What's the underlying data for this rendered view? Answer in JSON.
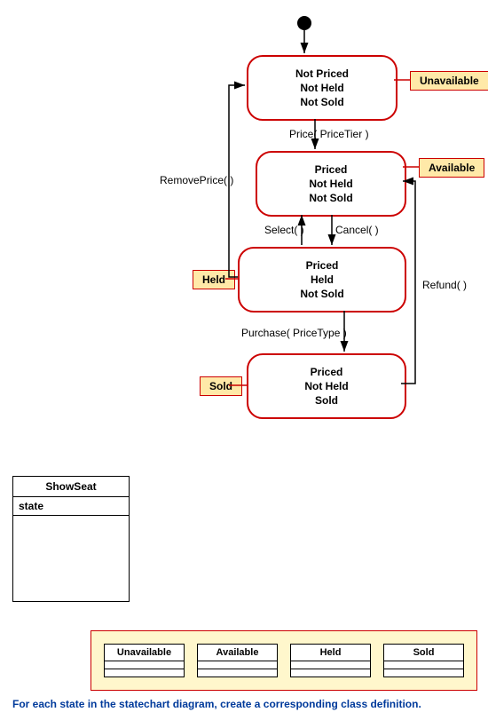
{
  "chart_data": {
    "type": "statechart",
    "initial": "s1",
    "states": [
      {
        "id": "s1",
        "lines": [
          "Not Priced",
          "Not Held",
          "Not Sold"
        ],
        "note": "Unavailable"
      },
      {
        "id": "s2",
        "lines": [
          "Priced",
          "Not Held",
          "Not Sold"
        ],
        "note": "Available"
      },
      {
        "id": "s3",
        "lines": [
          "Priced",
          "Held",
          "Not Sold"
        ],
        "note": "Held"
      },
      {
        "id": "s4",
        "lines": [
          "Priced",
          "Not Held",
          "Sold"
        ],
        "note": "Sold"
      }
    ],
    "transitions": [
      {
        "from": "initial",
        "to": "s1",
        "label": ""
      },
      {
        "from": "s1",
        "to": "s2",
        "label": "Price( PriceTier )"
      },
      {
        "from": "s2",
        "to": "s3",
        "label": "Select( )"
      },
      {
        "from": "s3",
        "to": "s2",
        "label": "Cancel( )"
      },
      {
        "from": "s3",
        "to": "s1",
        "label": "RemovePrice( )"
      },
      {
        "from": "s3",
        "to": "s4",
        "label": "Purchase( PriceType )"
      },
      {
        "from": "s4",
        "to": "s2",
        "label": "Refund( )"
      }
    ]
  },
  "states": {
    "s1": {
      "l1": "Not Priced",
      "l2": "Not Held",
      "l3": "Not Sold"
    },
    "s2": {
      "l1": "Priced",
      "l2": "Not Held",
      "l3": "Not Sold"
    },
    "s3": {
      "l1": "Priced",
      "l2": "Held",
      "l3": "Not Sold"
    },
    "s4": {
      "l1": "Priced",
      "l2": "Not Held",
      "l3": "Sold"
    }
  },
  "notes": {
    "s1": "Unavailable",
    "s2": "Available",
    "s3": "Held",
    "s4": "Sold"
  },
  "transitions": {
    "t_price": "Price( PriceTier )",
    "t_select": "Select( )",
    "t_cancel": "Cancel( )",
    "t_remove": "RemovePrice( )",
    "t_purchase": "Purchase( PriceType )",
    "t_refund": "Refund( )"
  },
  "classbox": {
    "title": "ShowSeat",
    "attr": "state"
  },
  "panel": {
    "c1": "Unavailable",
    "c2": "Available",
    "c3": "Held",
    "c4": "Sold"
  },
  "caption": "For each state in the statechart diagram, create a corresponding class definition."
}
